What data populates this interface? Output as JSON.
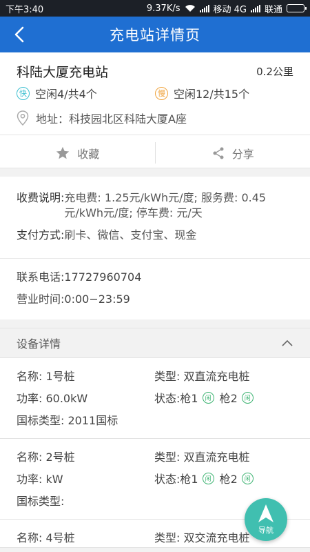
{
  "status_bar": {
    "time": "下午3:40",
    "speed": "9.37K/s",
    "carrier1": "移动 4G",
    "carrier2": "联通"
  },
  "header": {
    "title": "充电站详情页"
  },
  "station": {
    "name": "科陆大厦充电站",
    "distance": "0.2公里",
    "fast_badge": "快",
    "fast_text": "空闲4/共4个",
    "slow_badge": "慢",
    "slow_text": "空闲12/共15个",
    "address": "地址：科技园北区科陆大厦A座"
  },
  "actions": {
    "favorite": "收藏",
    "share": "分享"
  },
  "fees": {
    "fee_label": "收费说明: ",
    "fee_value": "充电费: 1.25元/kWh元/度; 服务费: 0.45元/kWh元/度; 停车费: 元/天",
    "pay_label": "支付方式: ",
    "pay_value": "刷卡、微信、支付宝、现金"
  },
  "contact": {
    "phone_label": "联系电话: ",
    "phone_value": "17727960704",
    "hours_label": "营业时间: ",
    "hours_value": "0:00−23:59"
  },
  "devices_section": {
    "title": "设备详情"
  },
  "devices": [
    {
      "name": "名称: 1号桩",
      "type": "类型: 双直流充电桩",
      "power": "功率: 60.0kW",
      "status_label": "状态: ",
      "gun1": "枪1",
      "gun2": "枪2",
      "idle": "闲",
      "standard": "国标类型: 2011国标"
    },
    {
      "name": "名称: 2号桩",
      "type": "类型: 双直流充电桩",
      "power": "功率: kW",
      "status_label": "状态: ",
      "gun1": "枪1",
      "gun2": "枪2",
      "idle": "闲",
      "standard": "国标类型: "
    },
    {
      "name": "名称: 4号桩",
      "type": "类型: 双交流充电桩"
    }
  ],
  "nav_button": {
    "label": "导航"
  },
  "colors": {
    "appbar": "#1f6fd2",
    "fast": "#3bbfd0",
    "slow": "#f0a33c",
    "idle": "#3cb371",
    "fab": "#40bfb0"
  }
}
